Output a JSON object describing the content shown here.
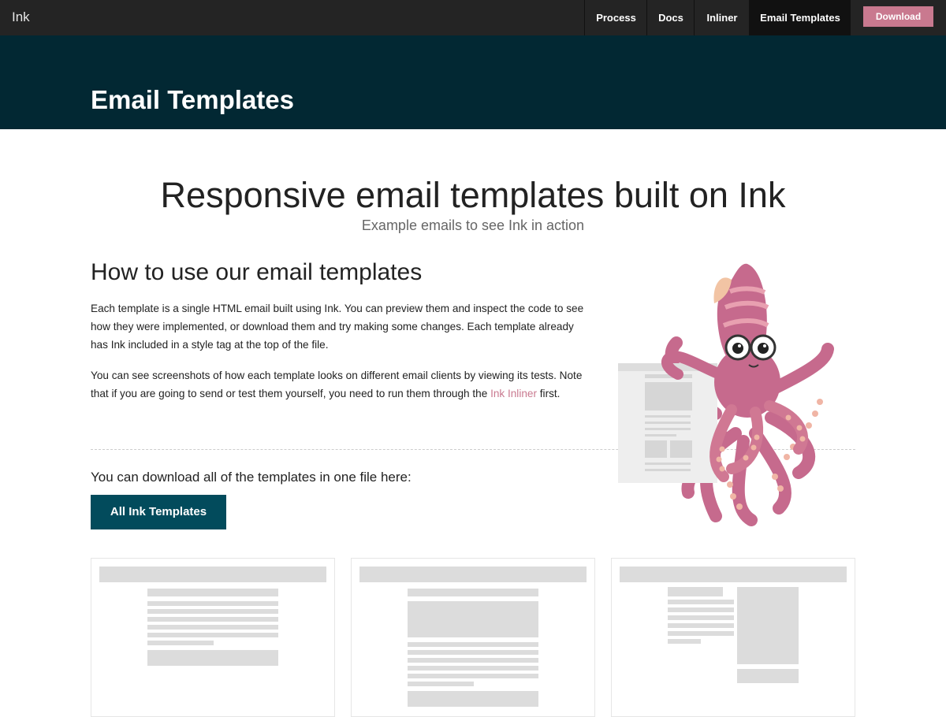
{
  "nav": {
    "brand": "Ink",
    "items": [
      {
        "label": "Process"
      },
      {
        "label": "Docs"
      },
      {
        "label": "Inliner"
      },
      {
        "label": "Email Templates",
        "active": true
      }
    ],
    "download_label": "Download"
  },
  "header": {
    "title": "Email Templates"
  },
  "main": {
    "headline": "Responsive email templates built on Ink",
    "subheadline": "Example emails to see Ink in action",
    "howto_title": "How to use our email templates",
    "para1": "Each template is a single HTML email built using Ink. You can preview them and inspect the code to see how they were implemented, or download them and try making some changes. Each template already has Ink included in a style tag at the top of the file.",
    "para2_before": "You can see screenshots of how each template looks on different email clients by viewing its tests. Note that if you are going to send or test them yourself, you need to run them through the ",
    "para2_link": "Ink Inliner",
    "para2_after": " first.",
    "download_text": "You can download all of the templates in one file here:",
    "download_button": "All Ink Templates"
  },
  "colors": {
    "nav_bg": "#242424",
    "header_bg": "#022833",
    "accent_pink": "#c9798f",
    "button_teal": "#024b5c"
  },
  "illustration": {
    "icon": "octopus-mascot-icon"
  },
  "templates_icon": "template-preview-icon"
}
